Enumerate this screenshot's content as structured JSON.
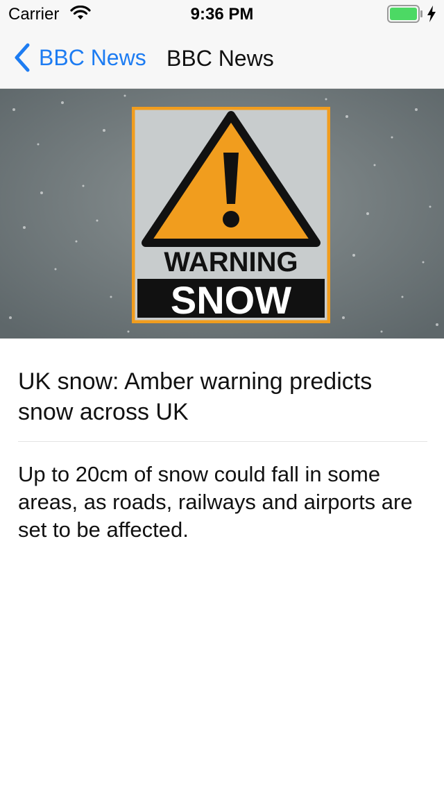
{
  "status_bar": {
    "carrier": "Carrier",
    "time": "9:36 PM",
    "battery_color": "#4cd964"
  },
  "nav": {
    "back_label": "BBC News",
    "title": "BBC News",
    "accent_color": "#1d7cf2"
  },
  "hero": {
    "sign_top": "WARNING",
    "sign_bottom": "SNOW",
    "sign_color": "#f19d1e"
  },
  "article": {
    "headline": "UK snow: Amber warning predicts snow across UK",
    "summary": "Up to 20cm of snow could fall in some areas, as roads, railways and airports are set to be affected."
  },
  "icons": [
    "wifi-icon",
    "battery-icon",
    "charging-bolt-icon",
    "chevron-left-icon",
    "warning-triangle-icon"
  ]
}
